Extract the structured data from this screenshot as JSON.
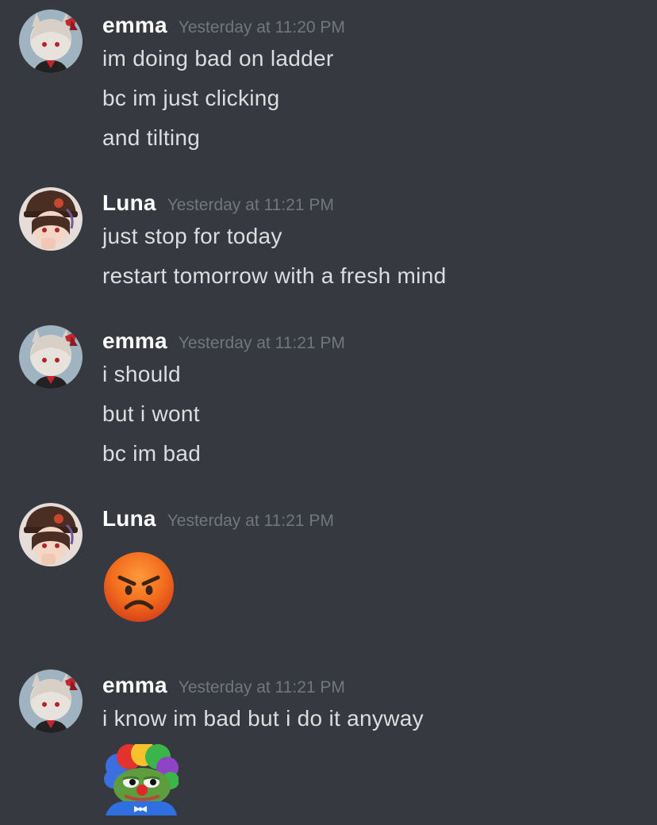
{
  "messages": [
    {
      "author": "emma",
      "timestamp": "Yesterday at 11:20 PM",
      "avatar": "emma-avatar",
      "lines": [
        "im doing bad on ladder",
        "bc im just clicking",
        "and tilting"
      ]
    },
    {
      "author": "Luna",
      "timestamp": "Yesterday at 11:21 PM",
      "avatar": "luna-avatar",
      "lines": [
        "just stop for today",
        "restart tomorrow with a fresh mind"
      ]
    },
    {
      "author": "emma",
      "timestamp": "Yesterday at 11:21 PM",
      "avatar": "emma-avatar",
      "lines": [
        "i should",
        "but i wont",
        "bc im bad"
      ]
    },
    {
      "author": "Luna",
      "timestamp": "Yesterday at 11:21 PM",
      "avatar": "luna-avatar",
      "emoji": "angry-face-emoji"
    },
    {
      "author": "emma",
      "timestamp": "Yesterday at 11:21 PM",
      "avatar": "emma-avatar",
      "lines": [
        "i know im bad but i do it anyway"
      ],
      "emoji": "clown-pepe-emoji"
    }
  ],
  "colors": {
    "background": "#36393f",
    "username": "#ffffff",
    "text": "#dcddde",
    "timestamp": "#72767d"
  }
}
